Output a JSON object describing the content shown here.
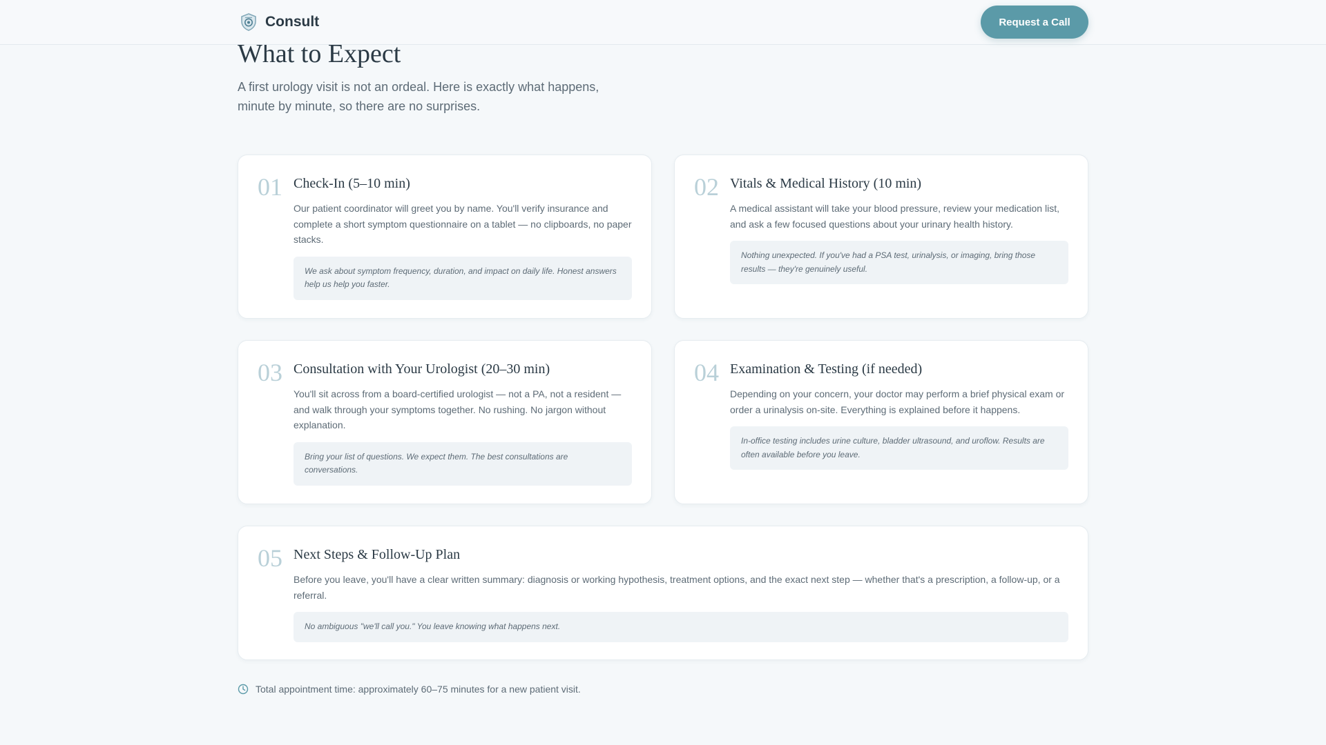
{
  "header": {
    "brand": "Consult",
    "cta_label": "Request a Call"
  },
  "main": {
    "title": "What to Expect",
    "intro": "A first urology visit is not an ordeal. Here is exactly what happens, minute by minute, so there are no surprises."
  },
  "steps": [
    {
      "number": "01",
      "title": "Check-In (5–10 min)",
      "description": "Our patient coordinator will greet you by name. You'll verify insurance and complete a short symptom questionnaire on a tablet — no clipboards, no paper stacks.",
      "note": "We ask about symptom frequency, duration, and impact on daily life. Honest answers help us help you faster."
    },
    {
      "number": "02",
      "title": "Vitals & Medical History (10 min)",
      "description": "A medical assistant will take your blood pressure, review your medication list, and ask a few focused questions about your urinary health history.",
      "note": "Nothing unexpected. If you've had a PSA test, urinalysis, or imaging, bring those results — they're genuinely useful."
    },
    {
      "number": "03",
      "title": "Consultation with Your Urologist (20–30 min)",
      "description": "You'll sit across from a board-certified urologist — not a PA, not a resident — and walk through your symptoms together. No rushing. No jargon without explanation.",
      "note": "Bring your list of questions. We expect them. The best consultations are conversations."
    },
    {
      "number": "04",
      "title": "Examination & Testing (if needed)",
      "description": "Depending on your concern, your doctor may perform a brief physical exam or order a urinalysis on-site. Everything is explained before it happens.",
      "note": "In-office testing includes urine culture, bladder ultrasound, and uroflow. Results are often available before you leave."
    },
    {
      "number": "05",
      "title": "Next Steps & Follow-Up Plan",
      "description": "Before you leave, you'll have a clear written summary: diagnosis or working hypothesis, treatment options, and the exact next step — whether that's a prescription, a follow-up, or a referral.",
      "note": "No ambiguous \"we'll call you.\" You leave knowing what happens next."
    }
  ],
  "footer": {
    "total_time": "Total appointment time: approximately 60–75 minutes for a new patient visit."
  },
  "icons": {
    "brand": "shield-logo-icon",
    "clock": "clock-icon"
  },
  "colors": {
    "accent": "#5b9aa8",
    "step_number": "#b9d0d8",
    "background": "#f5f8fa"
  }
}
